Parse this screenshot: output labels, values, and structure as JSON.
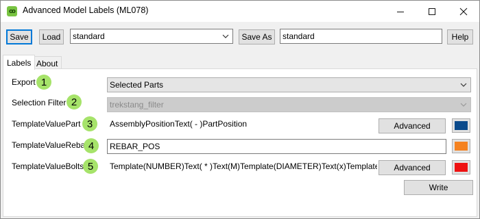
{
  "window": {
    "title": "Advanced Model Labels (ML078)",
    "app_icon_text": "ꝏ"
  },
  "toolbar": {
    "save_label": "Save",
    "load_label": "Load",
    "preset_value": "standard",
    "save_as_label": "Save As",
    "save_as_value": "standard",
    "help_label": "Help"
  },
  "tabs": [
    {
      "label": "Labels",
      "active": true
    },
    {
      "label": "About",
      "active": false
    }
  ],
  "rows": {
    "export": {
      "label": "Export",
      "step": "1",
      "value": "Selected Parts"
    },
    "selection_filter": {
      "label": "Selection Filter",
      "step": "2",
      "value": "trekstang_filter"
    },
    "part": {
      "label": "TemplateValuePart",
      "step": "3",
      "value": "AssemblyPositionText( - )PartPosition",
      "advanced_label": "Advanced",
      "color": "#0b4a8b"
    },
    "rebar": {
      "label": "TemplateValueRebar",
      "step": "4",
      "value": "REBAR_POS",
      "color": "#f58220"
    },
    "bolts": {
      "label": "TemplateValueBolts",
      "step": "5",
      "value": "Template(NUMBER)Text( * )Text(M)Template(DIAMETER)Text(x)Template(LENGT",
      "advanced_label": "Advanced",
      "color": "#ee1111"
    }
  },
  "write_label": "Write"
}
